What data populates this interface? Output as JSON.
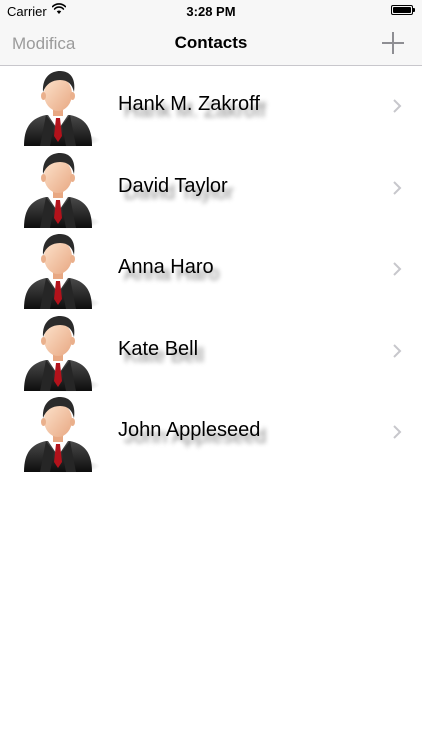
{
  "status_bar": {
    "carrier": "Carrier",
    "time": "3:28 PM",
    "icons": [
      "wifi-icon",
      "battery-icon"
    ]
  },
  "nav_bar": {
    "edit_label": "Modifica",
    "title": "Contacts",
    "add_icon": "plus-icon"
  },
  "contacts": [
    {
      "name": "Hank M. Zakroff",
      "avatar_icon": "businessman-avatar-icon"
    },
    {
      "name": "David Taylor",
      "avatar_icon": "businessman-avatar-icon"
    },
    {
      "name": "Anna Haro",
      "avatar_icon": "businessman-avatar-icon"
    },
    {
      "name": "Kate Bell",
      "avatar_icon": "businessman-avatar-icon"
    },
    {
      "name": "John Appleseed",
      "avatar_icon": "businessman-avatar-icon"
    }
  ],
  "colors": {
    "bar_background": "#f7f7f7",
    "edit_button": "#9b9b9b",
    "chevron": "#c7c7cc",
    "tie": "#b3121b"
  }
}
